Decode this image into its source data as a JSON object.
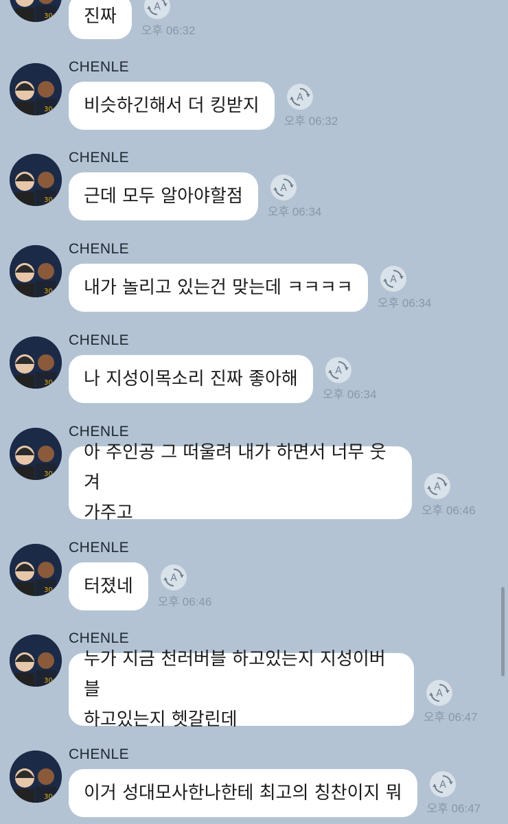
{
  "chat": {
    "ampm": "오후",
    "messages": [
      {
        "sender": "",
        "text": "진짜",
        "time": "06:32"
      },
      {
        "sender": "CHENLE",
        "text": "비슷하긴해서 더 킹받지",
        "time": "06:32"
      },
      {
        "sender": "CHENLE",
        "text": "근데 모두 알아야할점",
        "time": "06:34"
      },
      {
        "sender": "CHENLE",
        "text": "내가 놀리고 있는건 맞는데 ㅋㅋㅋㅋ",
        "time": "06:34"
      },
      {
        "sender": "CHENLE",
        "text": "나 지성이목소리 진짜 좋아해",
        "time": "06:34"
      },
      {
        "sender": "CHENLE",
        "text": "아 주인공 그 떠울려 내가 하면서 너무 웃겨\n가주고",
        "time": "06:46"
      },
      {
        "sender": "CHENLE",
        "text": "터졌네",
        "time": "06:46"
      },
      {
        "sender": "CHENLE",
        "text": "누가 지금 천러버블 하고있는지 지성이버블\n하고있는지 헷갈린데",
        "time": "06:47"
      },
      {
        "sender": "CHENLE",
        "text": "이거 성대모사한나한테 최고의 칭찬이지 뭐",
        "time": "06:47"
      }
    ]
  },
  "icons": {
    "avatar": "profile-photo",
    "translate": "auto-translate-a-icon"
  },
  "colors": {
    "background": "#b3c3d3",
    "bubble": "#ffffff",
    "time": "#8797a6"
  }
}
